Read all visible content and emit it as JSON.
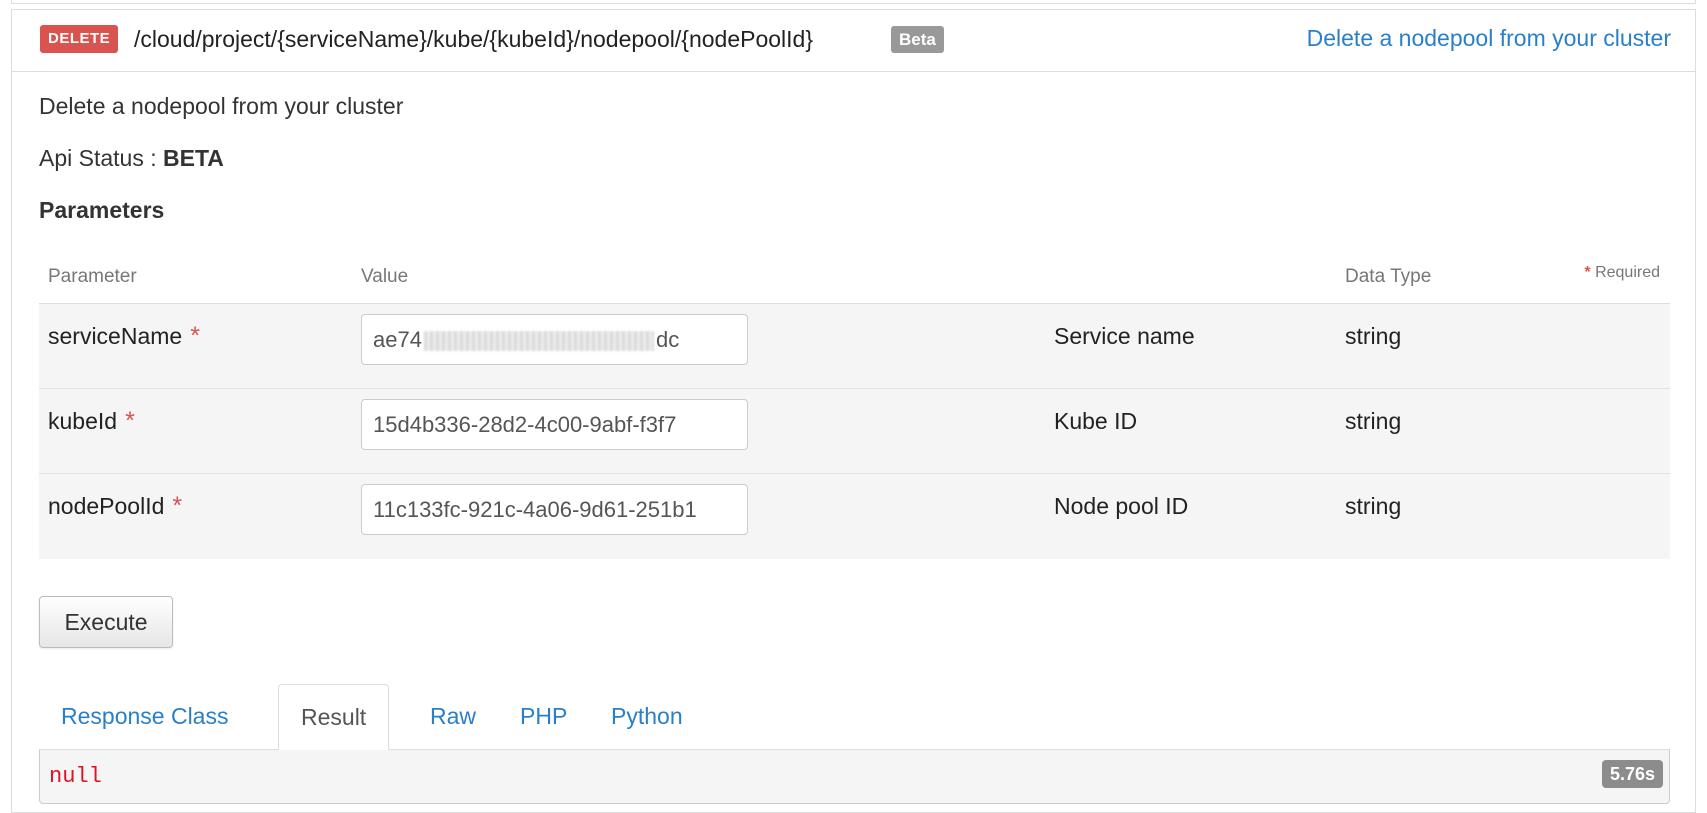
{
  "operation": {
    "method": "DELETE",
    "path": "/cloud/project/{serviceName}/kube/{kubeId}/nodepool/{nodePoolId}",
    "badge": "Beta",
    "summary": "Delete a nodepool from your cluster",
    "description": "Delete a nodepool from your cluster",
    "status_label": "Api Status :",
    "status_value": "BETA"
  },
  "parameters": {
    "title": "Parameters",
    "headers": {
      "parameter": "Parameter",
      "value": "Value",
      "data_type": "Data Type",
      "required_star": "*",
      "required": "Required"
    },
    "rows": [
      {
        "name": "serviceName",
        "value_start": "ae74",
        "value_end": "dc",
        "value_obscured": true,
        "description": "Service name",
        "type": "string"
      },
      {
        "name": "kubeId",
        "value": "15d4b336-28d2-4c00-9abf-f3f7",
        "description": "Kube ID",
        "type": "string"
      },
      {
        "name": "nodePoolId",
        "value": "11c133fc-921c-4a06-9d61-251b1",
        "description": "Node pool ID",
        "type": "string"
      }
    ]
  },
  "execute_label": "Execute",
  "tabs": [
    {
      "label": "Response Class",
      "active": false
    },
    {
      "label": "Result",
      "active": true
    },
    {
      "label": "Raw",
      "active": false
    },
    {
      "label": "PHP",
      "active": false
    },
    {
      "label": "Python",
      "active": false
    }
  ],
  "result": {
    "value": "null",
    "timing": "5.76s"
  },
  "colors": {
    "delete": "#d9534f",
    "link": "#2a7fc9",
    "beta": "#999999",
    "null": "#e3101e"
  }
}
